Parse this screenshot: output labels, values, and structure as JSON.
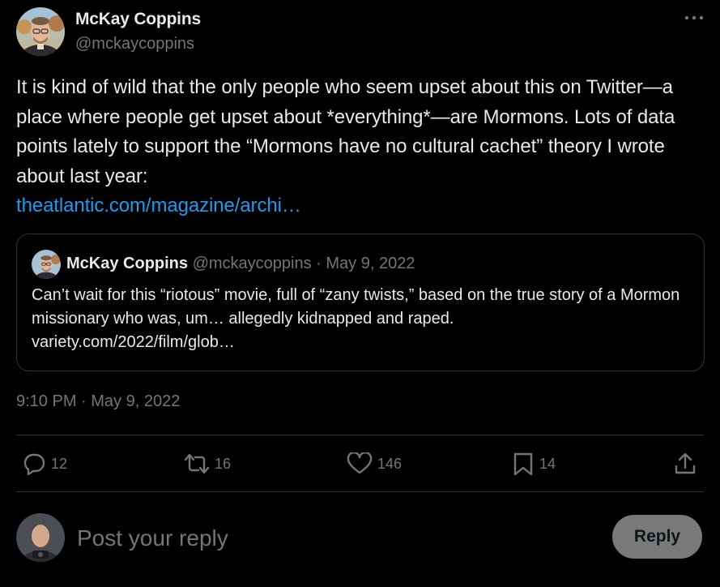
{
  "author": {
    "name": "McKay Coppins",
    "handle": "@mckaycoppins",
    "avatar_icon": "person-avatar"
  },
  "tweet": {
    "text": "It is kind of wild that the only people who seem upset about this on Twitter—a place where people get upset about *everything*—are Mormons. Lots of data points lately to support the “Mormons have no cultural cachet” theory I wrote about last year:",
    "link": "theatlantic.com/magazine/archi…"
  },
  "quote": {
    "name": "McKay Coppins",
    "meta": "@mckaycoppins · May 9, 2022",
    "text": "Can’t wait for this “riotous” movie, full of “zany twists,” based on the true story of a Mormon missionary who was, um… allegedly kidnapped and raped.",
    "link": "variety.com/2022/film/glob…"
  },
  "timestamp": "9:10 PM · May 9, 2022",
  "actions": {
    "replies": "12",
    "reposts": "16",
    "likes": "146",
    "bookmarks": "14"
  },
  "composer": {
    "placeholder": "Post your reply",
    "button_label": "Reply"
  },
  "colors": {
    "background": "#000000",
    "text": "#e7e9ea",
    "secondary": "#71767b",
    "link": "#1d9bf0",
    "border": "#2f3336",
    "reply_button": "#787a7a"
  }
}
